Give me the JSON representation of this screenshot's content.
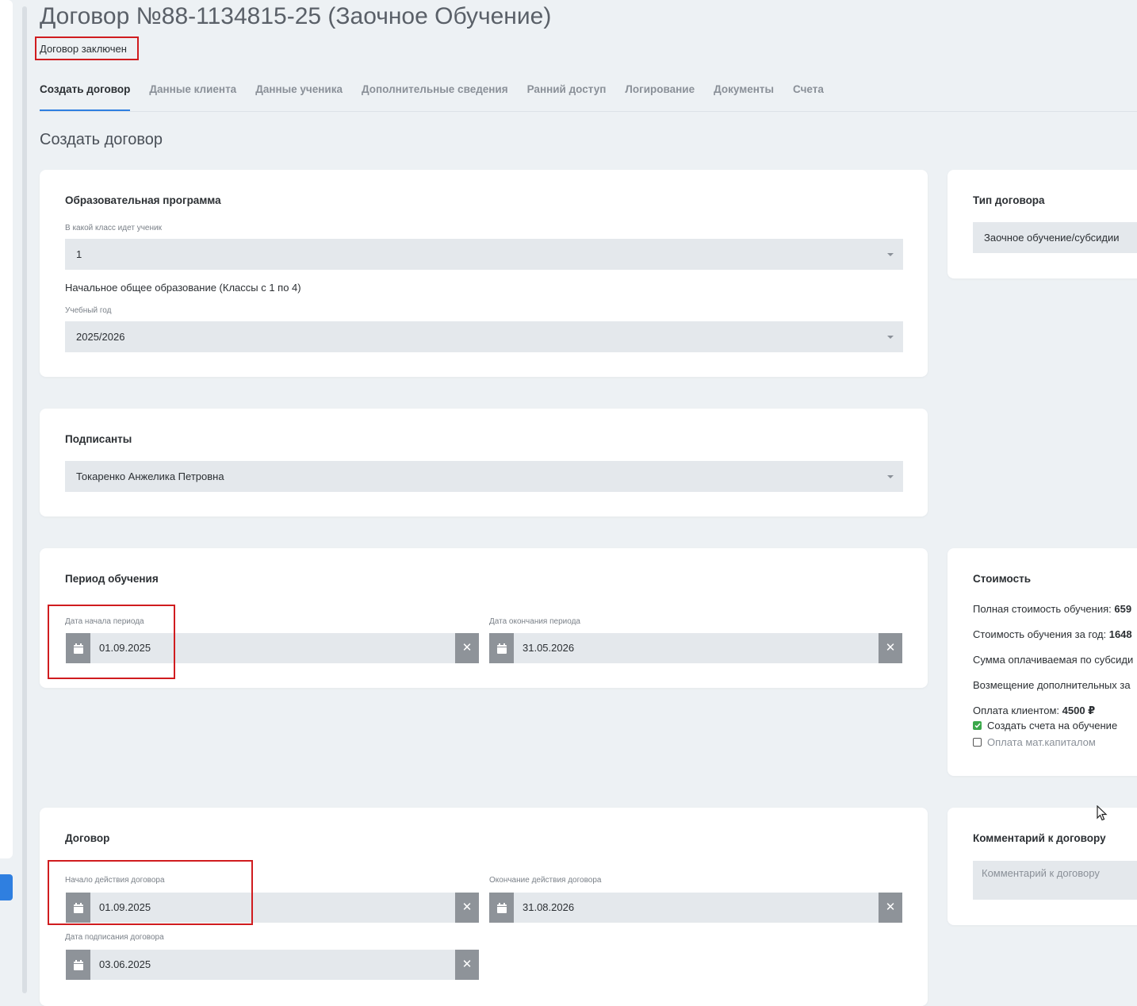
{
  "header": {
    "title": "Договор №88-1134815-25 (Заочное Обучение)",
    "status": "Договор заключен"
  },
  "tabs": [
    {
      "label": "Создать договор",
      "active": true
    },
    {
      "label": "Данные клиента"
    },
    {
      "label": "Данные ученика"
    },
    {
      "label": "Дополнительные сведения"
    },
    {
      "label": "Ранний доступ"
    },
    {
      "label": "Логирование"
    },
    {
      "label": "Документы"
    },
    {
      "label": "Счета"
    }
  ],
  "section_title": "Создать договор",
  "program": {
    "title": "Образовательная программа",
    "grade_label": "В какой класс идет ученик",
    "grade_value": "1",
    "level_text": "Начальное общее образование (Классы с 1 по 4)",
    "year_label": "Учебный год",
    "year_value": "2025/2026"
  },
  "contract_type": {
    "title": "Тип договора",
    "value": "Заочное обучение/субсидии"
  },
  "signers": {
    "title": "Подписанты",
    "value": "Токаренко Анжелика Петровна"
  },
  "period": {
    "title": "Период обучения",
    "start_label": "Дата начала периода",
    "start_value": "01.09.2025",
    "end_label": "Дата окончания периода",
    "end_value": "31.05.2026"
  },
  "cost": {
    "title": "Стоимость",
    "full_label": "Полная стоимость обучения:",
    "full_value": "659",
    "year_label": "Стоимость обучения за год:",
    "year_value": "1648",
    "subsidy_label": "Сумма оплачиваемая по субсиди",
    "refund_label": "Возмещение дополнительных за",
    "client_label": "Оплата клиентом:",
    "client_value": "4500 ₽",
    "create_invoices_label": "Создать счета на обучение",
    "create_invoices_checked": true,
    "matcapital_label": "Оплата мат.капиталом",
    "matcapital_checked": false
  },
  "contract": {
    "title": "Договор",
    "start_label": "Начало действия договора",
    "start_value": "01.09.2025",
    "end_label": "Окончание действия договора",
    "end_value": "31.08.2026",
    "sign_label": "Дата подписания договора",
    "sign_value": "03.06.2025"
  },
  "comment": {
    "title": "Комментарий к договору",
    "placeholder": "Комментарий к договору"
  },
  "icons": {
    "calendar": "calendar-icon",
    "clear": "clear-icon",
    "caret": "chevron-down-icon",
    "cursor": "mouse-pointer-icon"
  },
  "colors": {
    "accent": "#2f7fe0",
    "highlight": "#d01c1f",
    "checkbox_on": "#3aa84a"
  }
}
